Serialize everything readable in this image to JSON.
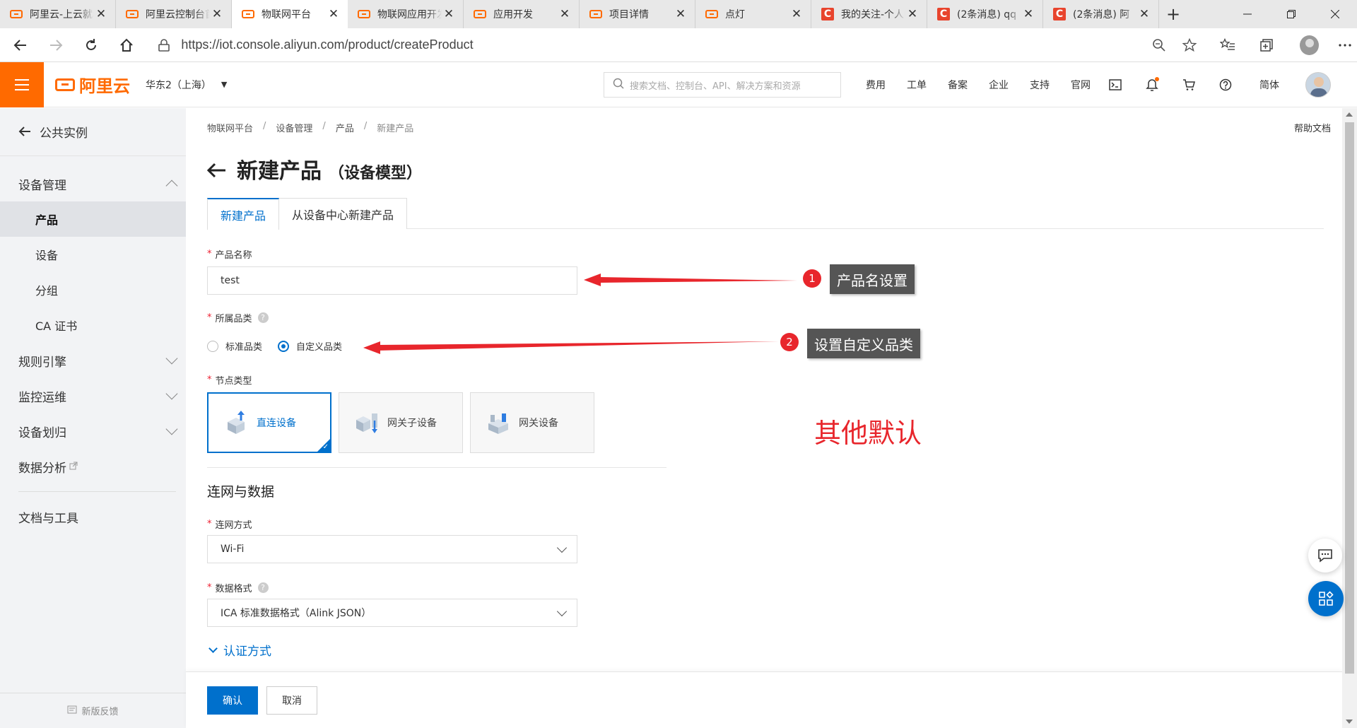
{
  "browser": {
    "tabs": [
      {
        "title": "阿里云-上云就看云栖号",
        "favicon": "aliyun-icon",
        "active": false
      },
      {
        "title": "阿里云控制台首页",
        "favicon": "aliyun-icon",
        "active": false
      },
      {
        "title": "物联网平台",
        "favicon": "aliyun-icon",
        "active": true
      },
      {
        "title": "物联网应用开发",
        "favicon": "aliyun-icon",
        "active": false
      },
      {
        "title": "应用开发",
        "favicon": "aliyun-icon",
        "active": false
      },
      {
        "title": "项目详情",
        "favicon": "aliyun-icon",
        "active": false
      },
      {
        "title": "点灯",
        "favicon": "aliyun-icon",
        "active": false
      },
      {
        "title": "我的关注-个人中心",
        "favicon": "csdn-icon",
        "active": false
      },
      {
        "title": "(2条消息) qq",
        "favicon": "csdn-icon",
        "active": false
      },
      {
        "title": "(2条消息) 阿",
        "favicon": "csdn-icon",
        "active": false
      }
    ],
    "close_glyph": "✕",
    "new_tab_glyph": "+",
    "url": "https://iot.console.aliyun.com/product/createProduct"
  },
  "console": {
    "logo_text": "阿里云",
    "region": "华东2（上海）",
    "search_placeholder": "搜索文档、控制台、API、解决方案和资源",
    "nav": [
      "费用",
      "工单",
      "备案",
      "企业",
      "支持",
      "官网"
    ],
    "lang": "简体"
  },
  "sidebar": {
    "back_label": "公共实例",
    "group_label": "设备管理",
    "items": [
      "产品",
      "设备",
      "分组",
      "CA 证书"
    ],
    "rows": [
      "规则引擎",
      "监控运维",
      "设备划归"
    ],
    "data_analysis": "数据分析",
    "docs_tools": "文档与工具",
    "feedback": "新版反馈"
  },
  "main": {
    "breadcrumb": [
      "物联网平台",
      "设备管理",
      "产品",
      "新建产品"
    ],
    "help_doc": "帮助文档",
    "title": "新建产品",
    "subtitle": "（设备模型）",
    "tabs": [
      "新建产品",
      "从设备中心新建产品"
    ],
    "form": {
      "product_name_label": "产品名称",
      "product_name_value": "test",
      "category_label": "所属品类",
      "category_options": [
        "标准品类",
        "自定义品类"
      ],
      "category_selected": "自定义品类",
      "node_type_label": "节点类型",
      "node_types": [
        "直连设备",
        "网关子设备",
        "网关设备"
      ],
      "node_type_selected": "直连设备",
      "section_network": "连网与数据",
      "network_label": "连网方式",
      "network_value": "Wi-Fi",
      "data_format_label": "数据格式",
      "data_format_value": "ICA 标准数据格式（Alink JSON）",
      "auth_toggle": "认证方式"
    },
    "confirm": "确认",
    "cancel": "取消"
  },
  "annotations": {
    "n1": "1",
    "label1": "产品名设置",
    "n2": "2",
    "label2": "设置自定义品类",
    "note": "其他默认"
  },
  "colors": {
    "brand_orange": "#ff6a00",
    "primary_blue": "#0070cc",
    "annotation_red": "#e8262c"
  }
}
